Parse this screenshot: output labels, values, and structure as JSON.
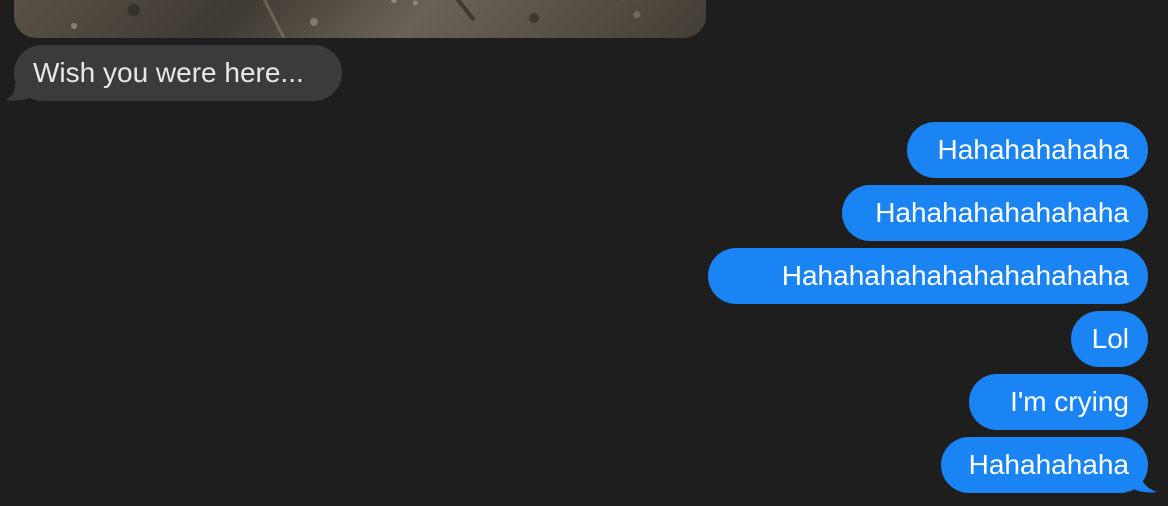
{
  "conversation": {
    "photo_alt": "photo attachment",
    "received": [
      {
        "text": "Wish you were here..."
      }
    ],
    "sent": [
      {
        "text": "Hahahahahaha"
      },
      {
        "text": "Hahahahahahahaha"
      },
      {
        "text": "Hahahahahahahahahahaha"
      },
      {
        "text": "Lol"
      },
      {
        "text": "I'm crying"
      },
      {
        "text": "Hahahahaha"
      }
    ]
  },
  "colors": {
    "background": "#1e1e1e",
    "received_bubble": "#3b3b3d",
    "sent_bubble": "#1a84f5",
    "text": "#ffffff"
  }
}
